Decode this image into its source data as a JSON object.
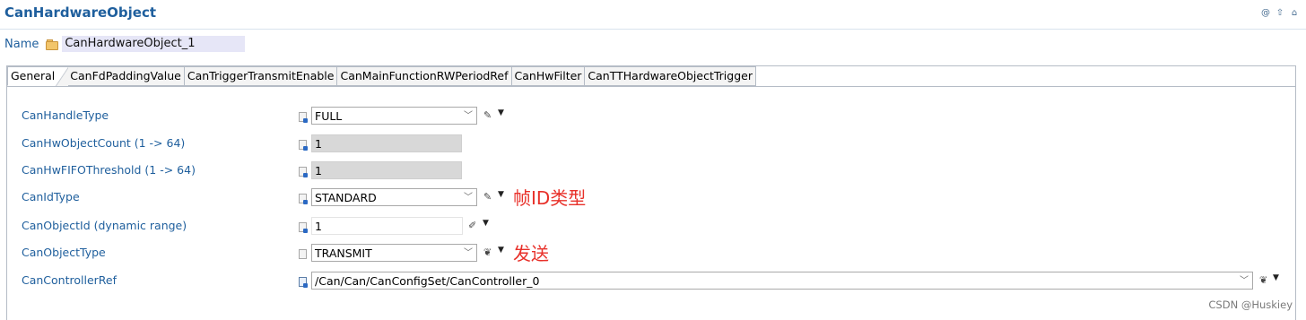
{
  "header": {
    "title": "CanHardwareObject",
    "icons": [
      "at-icon",
      "up-arrow-icon",
      "home-icon"
    ]
  },
  "name_field": {
    "label": "Name",
    "value": "CanHardwareObject_1"
  },
  "tabs": [
    {
      "label": "General",
      "active": true
    },
    {
      "label": "CanFdPaddingValue",
      "active": false
    },
    {
      "label": "CanTriggerTransmitEnable",
      "active": false
    },
    {
      "label": "CanMainFunctionRWPeriodRef",
      "active": false
    },
    {
      "label": "CanHwFilter",
      "active": false
    },
    {
      "label": "CanTTHardwareObjectTrigger",
      "active": false
    }
  ],
  "fields": [
    {
      "label": "CanHandleType",
      "value": "FULL",
      "type": "combo"
    },
    {
      "label": "CanHwObjectCount (1 -> 64)",
      "value": "1",
      "type": "readonly"
    },
    {
      "label": "CanHwFIFOThreshold (1 -> 64)",
      "value": "1",
      "type": "readonly"
    },
    {
      "label": "CanIdType",
      "value": "STANDARD",
      "type": "combo",
      "annotation": "帧ID类型"
    },
    {
      "label": "CanObjectId (dynamic range)",
      "value": "1",
      "type": "text"
    },
    {
      "label": "CanObjectType",
      "value": "TRANSMIT",
      "type": "combo",
      "annotation": "发送"
    },
    {
      "label": "CanControllerRef",
      "value": "/Can/Can/CanConfigSet/CanController_0",
      "type": "reference"
    }
  ],
  "watermark": "CSDN @Huskiey",
  "colors": {
    "label_blue": "#1f5f9d",
    "annotation_red": "#e8312a",
    "readonly_gray": "#d8d8d8",
    "name_highlight": "#e6e6f7"
  }
}
